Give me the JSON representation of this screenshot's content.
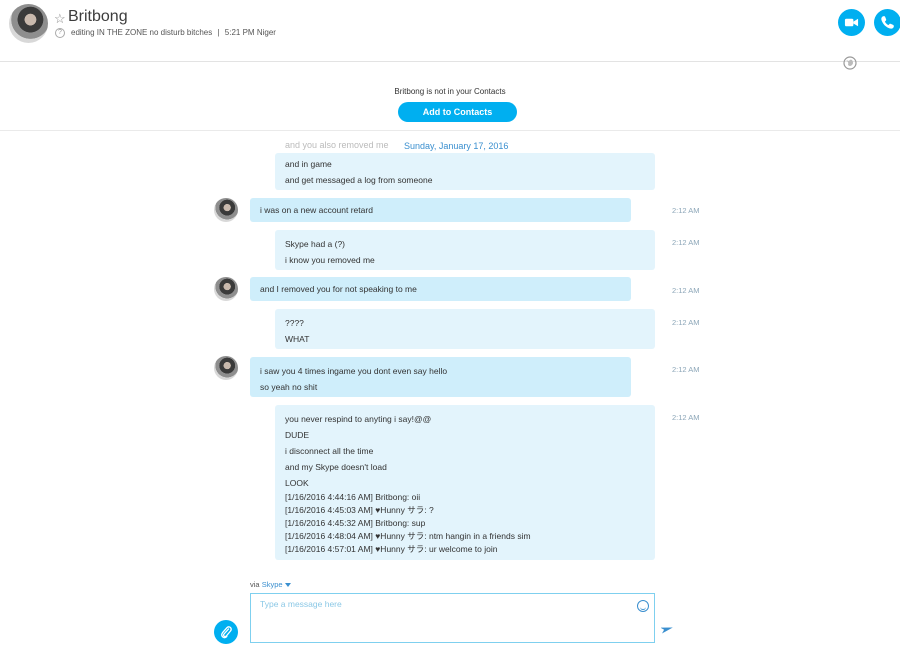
{
  "header": {
    "name": "Britbong",
    "star_icon": "star-icon",
    "mood": "editing IN THE ZONE no disturb bitches",
    "separator": "|",
    "local_time": "5:21 PM Niger"
  },
  "banner": {
    "text": "Britbong is not in your Contacts",
    "add_button": "Add to Contacts"
  },
  "chat": {
    "date_separator": "Sunday, January 17, 2016",
    "ghost_line": "and you also removed me",
    "messages": [
      {
        "dir": "out",
        "lines": [
          "and in game",
          "and get messaged a log from someone"
        ],
        "time": ""
      },
      {
        "dir": "in",
        "lines": [
          "i was on a new account retard"
        ],
        "time": "2:12 AM"
      },
      {
        "dir": "out",
        "lines": [
          "Skype had a (?)",
          "i know you removed me"
        ],
        "time": "2:12 AM"
      },
      {
        "dir": "in",
        "lines": [
          "and I removed you for not speaking to me"
        ],
        "time": "2:12 AM"
      },
      {
        "dir": "out",
        "lines": [
          "????",
          "WHAT"
        ],
        "time": "2:12 AM"
      },
      {
        "dir": "in",
        "lines": [
          "i saw you 4 times ingame you dont even say hello",
          "so yeah no shit"
        ],
        "time": "2:12 AM"
      },
      {
        "dir": "out",
        "lines": [
          "you never respind to anyting i say!@@",
          "DUDE",
          "i disconnect all the time",
          "and my Skype doesn't load",
          "LOOK"
        ],
        "log": [
          "[1/16/2016 4:44:16 AM] Britbong: oii",
          "[1/16/2016 4:45:03 AM] ♥Hunny サラ: ?",
          "[1/16/2016 4:45:32 AM] Britbong: sup",
          "[1/16/2016 4:48:04 AM] ♥Hunny サラ: ntm hangin in a friends sim",
          "[1/16/2016 4:57:01 AM] ♥Hunny サラ: ur welcome to join"
        ],
        "time": "2:12 AM"
      }
    ]
  },
  "compose": {
    "via_label": "via",
    "via_service": "Skype",
    "placeholder": "Type a message here"
  },
  "colors": {
    "accent": "#00aff0",
    "bubble_out": "#e3f4fc",
    "bubble_in": "#cfeefb",
    "link": "#3a8fcf"
  }
}
